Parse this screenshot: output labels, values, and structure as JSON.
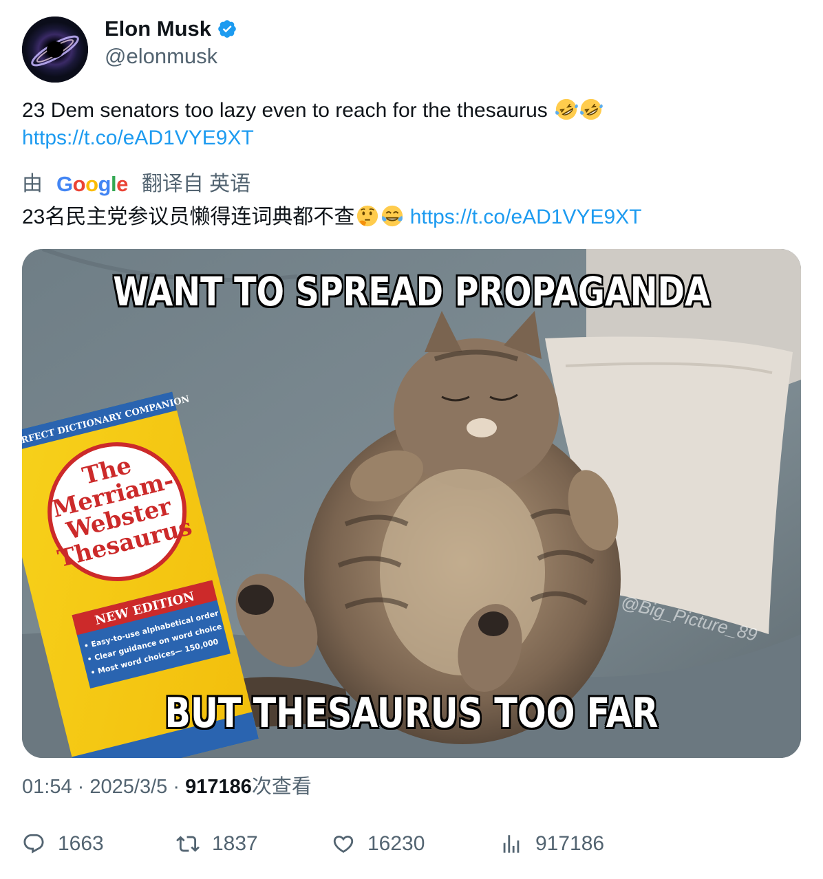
{
  "author": {
    "display_name": "Elon Musk",
    "handle": "@elonmusk",
    "verified": true
  },
  "tweet": {
    "text": "23 Dem senators too lazy even to reach for the thesaurus",
    "emojis": [
      "rolling-on-floor-laughing",
      "rolling-on-floor-laughing"
    ],
    "link": "https://t.co/eAD1VYE9XT"
  },
  "translation": {
    "prefix": "由",
    "provider_letters": [
      "G",
      "o",
      "o",
      "g",
      "l",
      "e"
    ],
    "suffix": "翻译自 英语",
    "text": "23名民主党参议员懒得连词典都不查",
    "emojis": [
      "thinking-face",
      "face-with-tears-of-joy"
    ],
    "link": "https://t.co/eAD1VYE9XT"
  },
  "media": {
    "top_caption": "WANT TO SPREAD PROPAGANDA",
    "bottom_caption": "BUT THESAURUS TOO FAR",
    "watermark": "@Big_Picture_89",
    "book": {
      "banner": "ERFECT DICTIONARY COMPANION",
      "title_lines": [
        "The",
        "Merriam-",
        "Webster",
        "Thesaurus"
      ],
      "edition": "NEW EDITION",
      "bullets": [
        "• Easy-to-use alphabetical order",
        "• Clear guidance on word choice",
        "• Most word choices— 150,000"
      ]
    }
  },
  "meta": {
    "time": "01:54",
    "separator": "·",
    "date": "2025/3/5",
    "views_count": "917186",
    "views_label": "次查看"
  },
  "actions": {
    "replies": "1663",
    "retweets": "1837",
    "likes": "16230",
    "views": "917186"
  },
  "colors": {
    "link": "#1d9bf0",
    "secondary_text": "#536471",
    "verified_badge": "#1d9bf0"
  }
}
